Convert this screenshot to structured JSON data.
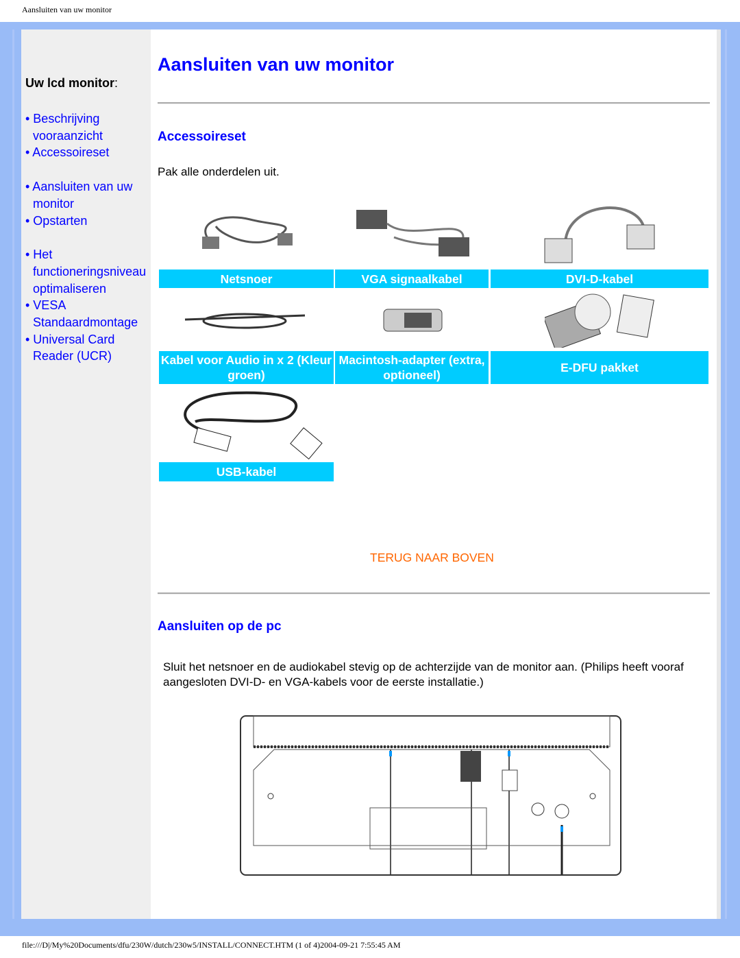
{
  "header": "Aansluiten van uw monitor",
  "footer": "file:///D|/My%20Documents/dfu/230W/dutch/230w5/INSTALL/CONNECT.HTM (1 of 4)2004-09-21 7:55:45 AM",
  "colors": {
    "frame": "#99bbf7",
    "link": "#0000ff",
    "caption_bg": "#00ccff",
    "back_to_top": "#ff6600"
  },
  "sidebar": {
    "title": "Uw lcd monitor",
    "colon": ":",
    "items": [
      {
        "label": "• Beschrijving vooraanzicht"
      },
      {
        "label": "• Accessoireset"
      },
      {
        "label": "• Aansluiten van uw monitor"
      },
      {
        "label": "• Opstarten"
      },
      {
        "label": "• Het functioneringsniveau optimaliseren"
      },
      {
        "label": "• VESA Standaardmontage"
      },
      {
        "label": "• Universal Card Reader (UCR)"
      }
    ]
  },
  "main": {
    "title": "Aansluiten van uw monitor",
    "section1": {
      "title": "Accessoireset",
      "text": "Pak alle onderdelen uit.",
      "items": [
        {
          "label": "Netsnoer"
        },
        {
          "label": "VGA signaalkabel"
        },
        {
          "label": "DVI-D-kabel"
        },
        {
          "label": "Kabel voor Audio in x 2 (Kleur groen)"
        },
        {
          "label": "Macintosh-adapter (extra, optioneel)"
        },
        {
          "label": "E-DFU pakket"
        },
        {
          "label": "USB-kabel"
        }
      ]
    },
    "back_to_top": "TERUG NAAR BOVEN",
    "section2": {
      "title": "Aansluiten op de pc",
      "text": "Sluit het netsnoer en de audiokabel stevig op de achterzijde van de monitor aan. (Philips heeft vooraf aangesloten DVI-D- en VGA-kabels voor de eerste installatie.)"
    }
  }
}
